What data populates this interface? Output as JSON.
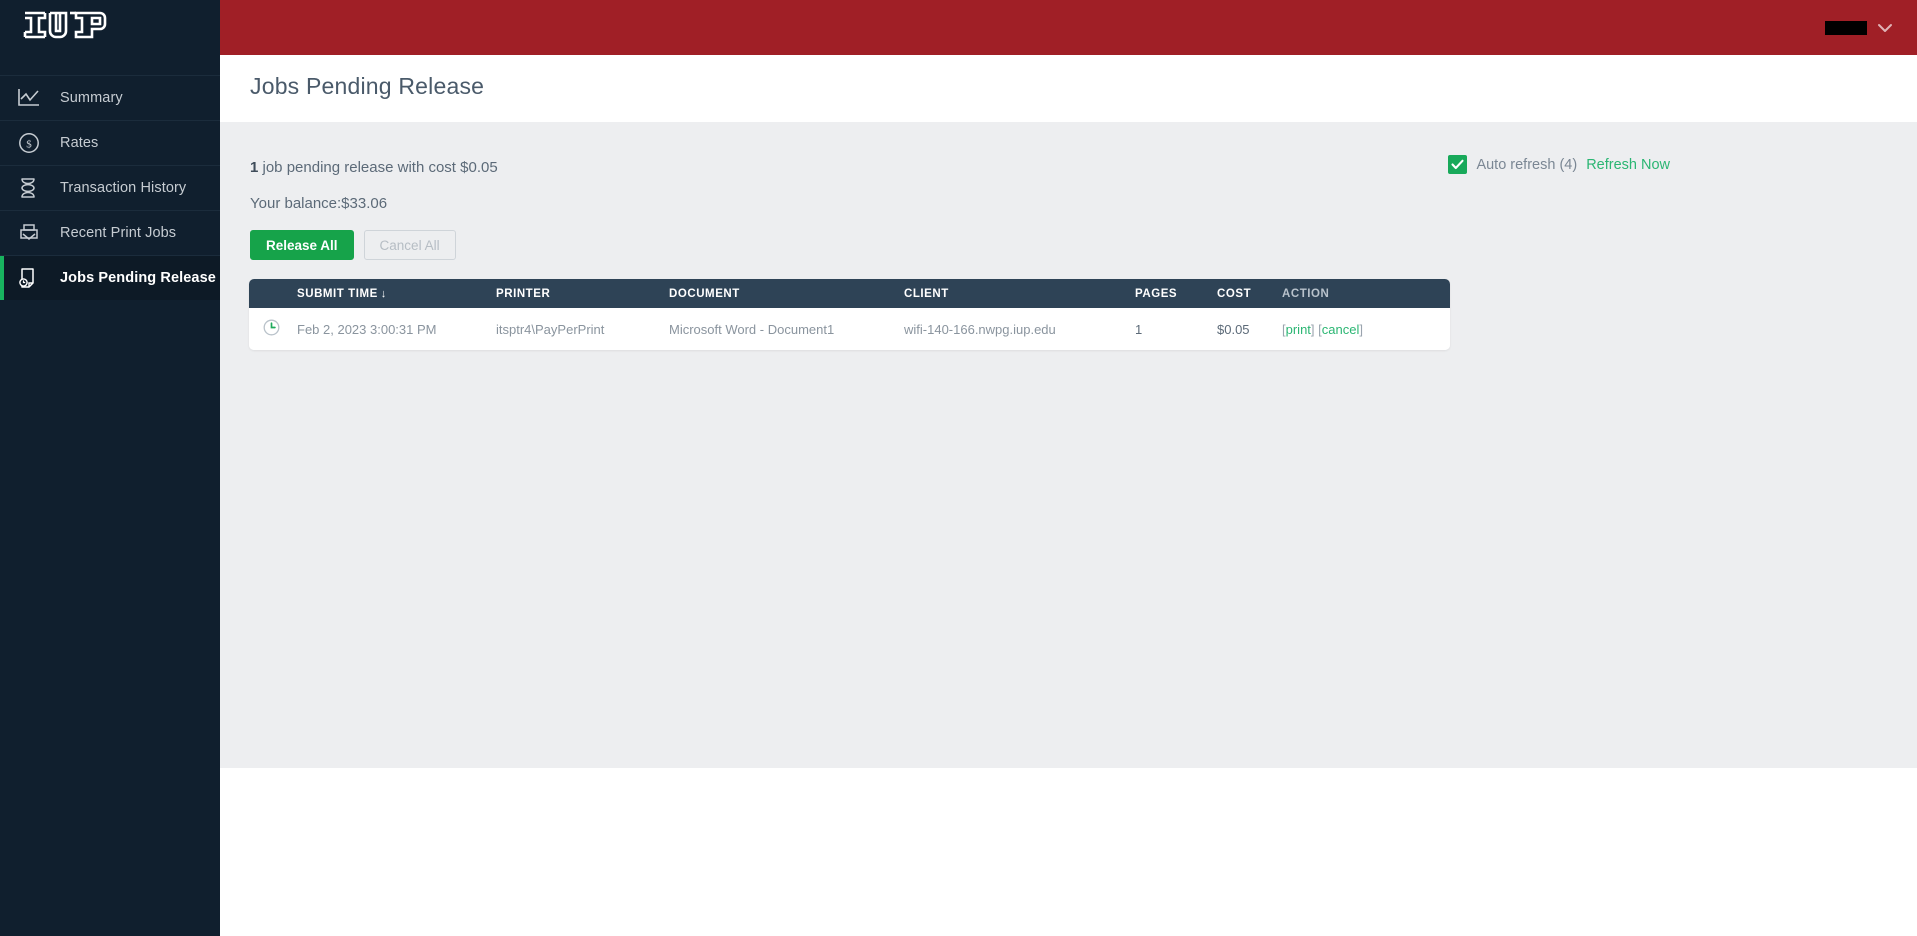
{
  "brand": {
    "logo_text": "IUP",
    "header_color": "#a01f26",
    "sidebar_color": "#101f2e",
    "accent_green": "#16a34a"
  },
  "topbar": {
    "user_name": "",
    "chevron_icon": "chevron-down-icon"
  },
  "sidebar": {
    "items": [
      {
        "label": "Summary",
        "icon": "chart-line-icon",
        "active": false
      },
      {
        "label": "Rates",
        "icon": "dollar-circle-icon",
        "active": false
      },
      {
        "label": "Transaction History",
        "icon": "hourglass-icon",
        "active": false
      },
      {
        "label": "Recent Print Jobs",
        "icon": "printer-icon",
        "active": false
      },
      {
        "label": "Jobs Pending Release",
        "icon": "document-clock-icon",
        "active": true
      }
    ]
  },
  "header": {
    "title": "Jobs Pending Release"
  },
  "summary": {
    "count": "1",
    "count_text": " job pending release with cost $0.05",
    "balance_label": "Your balance:$33.06"
  },
  "refresh": {
    "checkbox_icon": "checkmark-icon",
    "checked": true,
    "label": "Auto refresh (4)",
    "link": "Refresh Now"
  },
  "actions": {
    "release_all": "Release All",
    "cancel_all": "Cancel All"
  },
  "table": {
    "columns": [
      {
        "key": "icon",
        "label": ""
      },
      {
        "key": "time",
        "label": "SUBMIT TIME",
        "sorted": true,
        "sort_arrow": "↓"
      },
      {
        "key": "printer",
        "label": "PRINTER"
      },
      {
        "key": "document",
        "label": "DOCUMENT"
      },
      {
        "key": "client",
        "label": "CLIENT"
      },
      {
        "key": "pages",
        "label": "PAGES"
      },
      {
        "key": "cost",
        "label": "COST"
      },
      {
        "key": "action",
        "label": "ACTION"
      }
    ],
    "rows": [
      {
        "icon": "clock-icon",
        "time": "Feb 2, 2023 3:00:31 PM",
        "printer": "itsptr4\\PayPerPrint",
        "document": "Microsoft Word - Document1",
        "client": "wifi-140-166.nwpg.iup.edu",
        "pages": "1",
        "cost": "$0.05",
        "action_print": "print",
        "action_cancel": "cancel",
        "bracket_open": "[",
        "bracket_close": "]"
      }
    ]
  }
}
